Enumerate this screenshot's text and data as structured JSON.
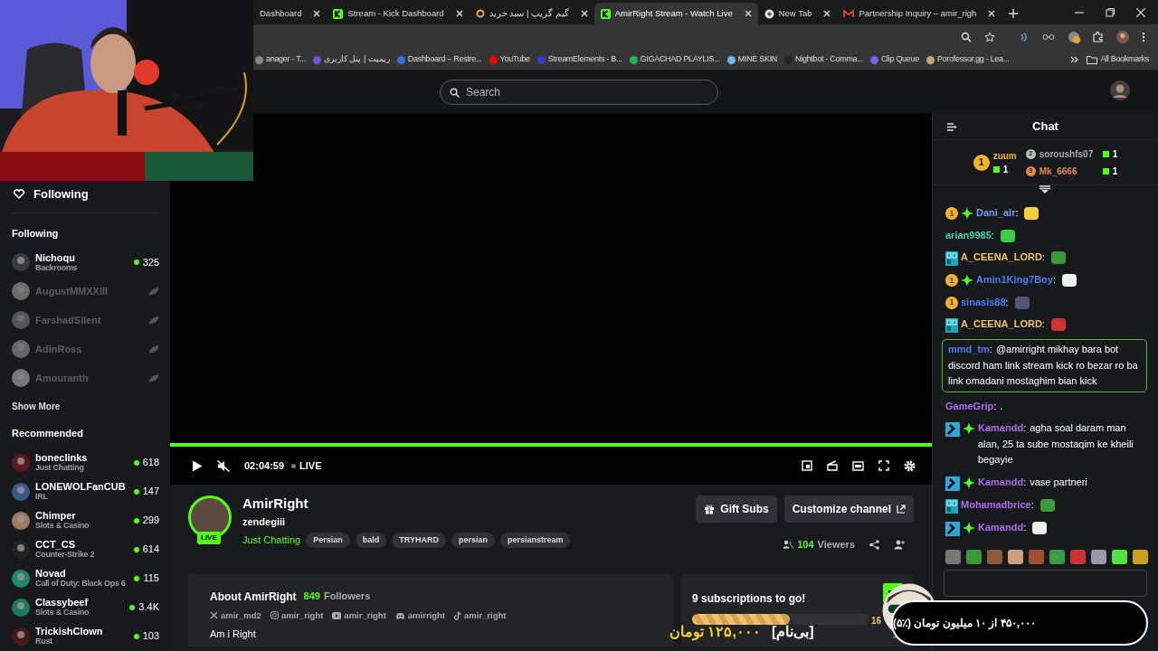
{
  "browser": {
    "tabs": [
      {
        "title": "Dashboard",
        "selected": false
      },
      {
        "title": "Stream - Kick Dashboard",
        "kind": "kick",
        "selected": false
      },
      {
        "title": "گیم گریپ | سبد خرید",
        "kind": "ring",
        "selected": false
      },
      {
        "title": "AmirRight Stream - Watch Live",
        "kind": "kick",
        "selected": true
      },
      {
        "title": "New Tab",
        "kind": "globe",
        "selected": false
      },
      {
        "title": "Partnership Inquiry – amir_righ",
        "kind": "mail",
        "selected": false
      }
    ],
    "bookmarks": [
      {
        "label": "anager - T...",
        "color": "#888888"
      },
      {
        "label": "ریمیت | پنل کاربری",
        "color": "#7b4fd6"
      },
      {
        "label": "Dashboard – Restre...",
        "color": "#3a6fe0"
      },
      {
        "label": "YouTube",
        "color": "#ff0000"
      },
      {
        "label": "StreamElements - B...",
        "color": "#3b3bdc"
      },
      {
        "label": "GIGACHAD PLAYLIS...",
        "color": "#1db954"
      },
      {
        "label": "MINE SKIN",
        "color": "#6fb7e8"
      },
      {
        "label": "Nightbot - Comma...",
        "color": "#222222"
      },
      {
        "label": "Clip Queue",
        "color": "#7a5cf0"
      },
      {
        "label": "Porofessor.gg - Lea...",
        "color": "#c9a27a"
      }
    ],
    "all_bookmarks": "All Bookmarks"
  },
  "search": {
    "placeholder": "Search"
  },
  "sidebar": {
    "header": "Following",
    "following_title": "Following",
    "following": [
      {
        "name": "Nichoqu",
        "category": "Backrooms",
        "viewers": "325",
        "live": true
      },
      {
        "name": "AugustMMXXIII",
        "live": false
      },
      {
        "name": "FarshadSilent",
        "live": false
      },
      {
        "name": "AdinRoss",
        "live": false
      },
      {
        "name": "Amouranth",
        "live": false
      }
    ],
    "show_more": "Show More",
    "recommended_title": "Recommended",
    "recommended": [
      {
        "name": "boneclinks",
        "category": "Just Chatting",
        "viewers": "618",
        "live": true
      },
      {
        "name": "LONEWOLFanCUB",
        "category": "IRL",
        "viewers": "147",
        "live": true
      },
      {
        "name": "Chimper",
        "category": "Slots & Casino",
        "viewers": "299",
        "live": true
      },
      {
        "name": "CCT_CS",
        "category": "Counter-Strike 2",
        "viewers": "614",
        "live": true
      },
      {
        "name": "Novad",
        "category": "Call of Duty: Black Ops 6",
        "viewers": "115",
        "live": true
      },
      {
        "name": "Classybeef",
        "category": "Slots & Casino",
        "viewers": "3.4K",
        "live": true
      },
      {
        "name": "TrickishClown",
        "category": "Rust",
        "viewers": "103",
        "live": true
      }
    ]
  },
  "player": {
    "time": "02:04:59",
    "live_label": "LIVE",
    "muted": true,
    "level": 1
  },
  "channel": {
    "name": "AmirRight",
    "title": "zendegiii",
    "live_badge": "LIVE",
    "category": "Just Chatting",
    "tags": [
      "Persian",
      "bald",
      "TRYHARD",
      "persian",
      "persianstream"
    ],
    "buttons": [
      "Gift Subs",
      "Customize channel"
    ],
    "viewers_count": "104",
    "viewers_label": "Viewers"
  },
  "about": {
    "title": "About AmirRight",
    "followers_count": "849",
    "followers_label": "Followers",
    "socials": [
      {
        "kind": "x",
        "handle": "amir_md2"
      },
      {
        "kind": "instagram",
        "handle": "amir_right"
      },
      {
        "kind": "youtube",
        "handle": "amir_right"
      },
      {
        "kind": "discord",
        "handle": "amirright"
      },
      {
        "kind": "tiktok",
        "handle": "amir_right"
      }
    ],
    "bio": "Am i Right"
  },
  "sub_goal": {
    "title": "9 subscriptions to go!",
    "level": 0.55,
    "count": "16"
  },
  "chat": {
    "title": "Chat",
    "leaderboard": [
      {
        "rank": "1",
        "name": "zuum",
        "count": "1",
        "color": "#f0b429"
      },
      {
        "rank": "2",
        "name": "soroushfs07",
        "count": "1",
        "color": "#b8b8b8"
      },
      {
        "rank": "3",
        "name": "Mk_6666",
        "count": "1",
        "color": "#e08a4a"
      }
    ],
    "messages": [
      {
        "user": "Dani_alr",
        "separator": ":",
        "color": "#6f9ef5",
        "badges": [
          {
            "kind": "sub",
            "label": "1"
          },
          {
            "kind": "gem"
          }
        ],
        "emote": true,
        "highlighted": false
      },
      {
        "user": "arian9985",
        "separator": ":",
        "color": "#4fd1a5",
        "emote": true,
        "highlighted": false
      },
      {
        "user": "A_CEENA_LORD",
        "separator": ":",
        "color": "#f0c36a",
        "badges": [
          {
            "kind": "og"
          }
        ],
        "emote": true,
        "highlighted": false
      },
      {
        "user": "Amin1King7Boy",
        "separator": ":",
        "color": "#4c7cf0",
        "badges": [
          {
            "kind": "sub",
            "label": "1"
          },
          {
            "kind": "gem"
          }
        ],
        "emote": true,
        "highlighted": false
      },
      {
        "user": "sinasis88",
        "separator": ":",
        "color": "#4c7cf0",
        "badges": [
          {
            "kind": "sub",
            "label": "1"
          }
        ],
        "emote": true,
        "highlighted": false
      },
      {
        "user": "A_CEENA_LORD",
        "separator": ":",
        "color": "#f0c36a",
        "badges": [
          {
            "kind": "og"
          }
        ],
        "emote": true,
        "highlighted": false
      },
      {
        "user": "mmd_tm",
        "separator": ":",
        "color": "#4c7cf0",
        "text": "@amirright mikhay bara bot discord ham link stream kick ro bezar ro ba link omadani mostaghim bian kick",
        "emote": false,
        "highlighted": true
      },
      {
        "user": "GameGrip",
        "separator": ":",
        "color": "#b06cf0",
        "text": ".",
        "emote": false,
        "highlighted": false
      },
      {
        "user": "Kamandd",
        "separator": ":",
        "color": "#b06cf0",
        "badges": [
          {
            "kind": "mod"
          },
          {
            "kind": "gem"
          }
        ],
        "text": "agha soal daram man alan, 25 ta sube mostaqim ke kheili begayie",
        "emote": false,
        "highlighted": false
      },
      {
        "user": "Kamandd",
        "separator": ":",
        "color": "#b06cf0",
        "badges": [
          {
            "kind": "mod"
          },
          {
            "kind": "gem"
          }
        ],
        "text": "vase partneri",
        "emote": false,
        "highlighted": false
      },
      {
        "user": "Mohamadbrice",
        "separator": ":",
        "color": "#b06cf0",
        "badges": [
          {
            "kind": "og"
          }
        ],
        "emote": true,
        "highlighted": false
      },
      {
        "user": "Kamandd",
        "separator": ":",
        "color": "#b06cf0",
        "badges": [
          {
            "kind": "mod"
          },
          {
            "kind": "gem"
          }
        ],
        "emote": true,
        "highlighted": false
      }
    ]
  },
  "overlay": {
    "donation_goal": "۴۵۰,۰۰۰ از ۱۰ میلیون تومان (٪۵)",
    "alert_name": "[بی‌نام]",
    "alert_amount": "۱۲۵,۰۰۰ تومان"
  }
}
